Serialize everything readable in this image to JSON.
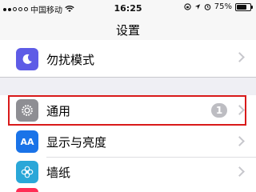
{
  "status_bar": {
    "carrier": "中国移动",
    "time": "16:25",
    "battery_text": "75%",
    "battery_level": 0.75
  },
  "nav": {
    "title": "设置"
  },
  "rows": [
    {
      "label": "勿扰模式",
      "icon": "moon-icon",
      "icon_color": "#5e5ce6"
    },
    {
      "label": "通用",
      "icon": "gear-icon",
      "icon_color": "#8e8e93",
      "badge": "1",
      "highlighted": true
    },
    {
      "label": "显示与亮度",
      "icon": "text-size-icon",
      "icon_color": "#1a73e8",
      "icon_text": "AA"
    },
    {
      "label": "墙纸",
      "icon": "flower-icon",
      "icon_color": "#2aa7d8"
    },
    {
      "label": "",
      "icon": "pink-app-icon",
      "icon_color": "#ff2d55"
    }
  ]
}
